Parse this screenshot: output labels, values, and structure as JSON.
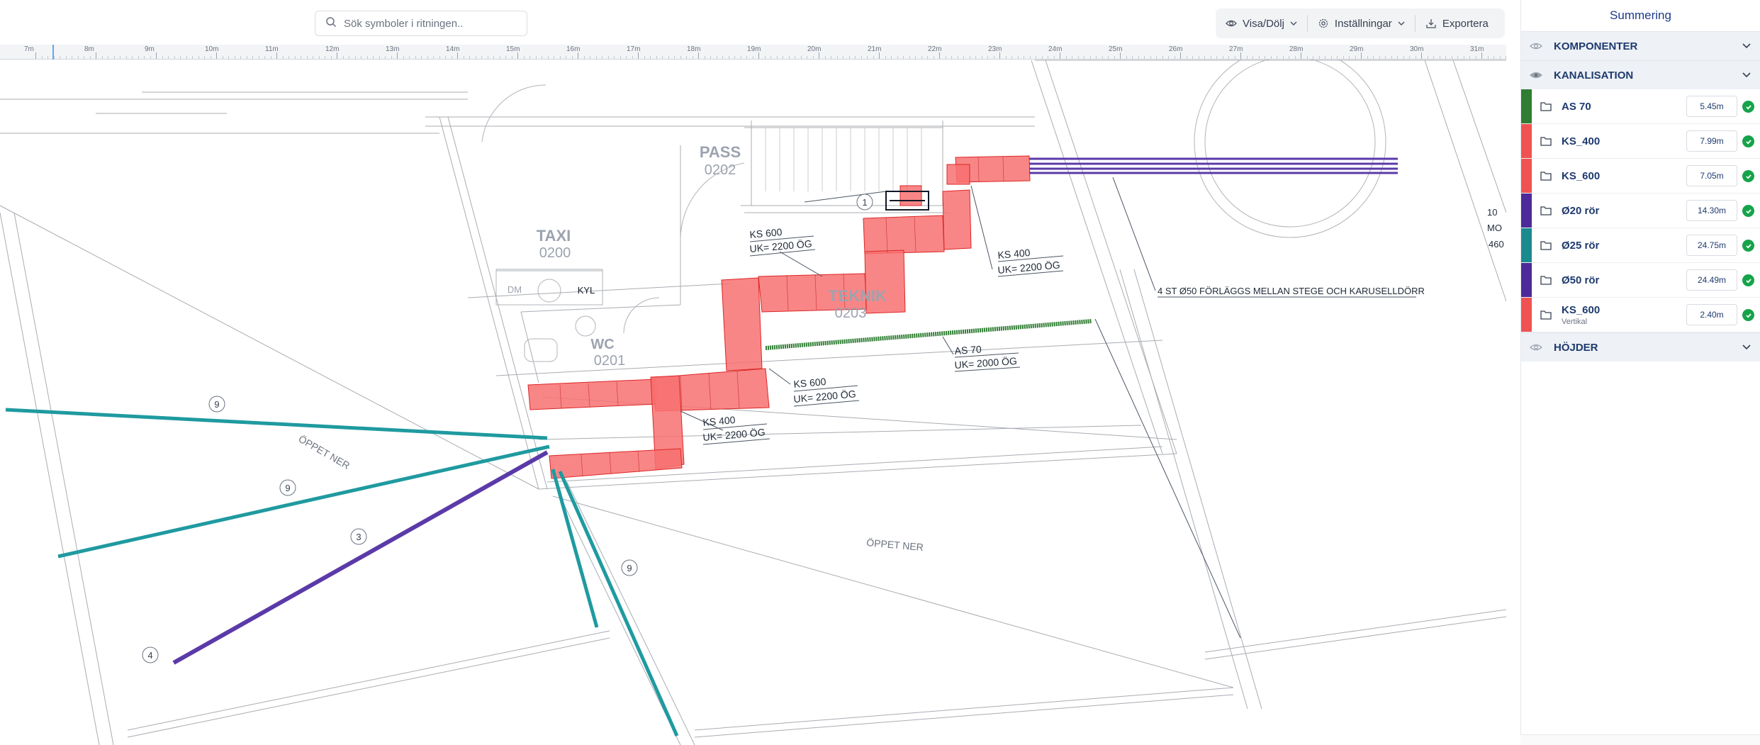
{
  "search": {
    "placeholder": "Sök symboler i ritningen.."
  },
  "toolbar": {
    "show_hide_label": "Visa/Dölj",
    "settings_label": "Inställningar",
    "export_label": "Exportera"
  },
  "ruler": {
    "labels": [
      "7m",
      "8m",
      "9m",
      "10m",
      "11m",
      "12m",
      "13m",
      "14m",
      "15m",
      "16m",
      "17m",
      "18m",
      "19m",
      "20m",
      "21m",
      "22m",
      "23m",
      "24m",
      "25m",
      "26m",
      "27m",
      "28m",
      "29m",
      "30m",
      "31m"
    ]
  },
  "drawing": {
    "rooms": [
      {
        "name": "PASS",
        "number": "0202"
      },
      {
        "name": "TAXI",
        "number": "0200"
      },
      {
        "name": "WC",
        "number": "0201"
      },
      {
        "name": "TEKNIK",
        "number": "0203"
      }
    ],
    "fixtures": {
      "dm": "DM",
      "kyl": "KYL"
    },
    "annotations": {
      "ks600_a": "KS 600",
      "ks600_a_uk": "UK= 2200 ÖG",
      "ks400_a": "KS 400",
      "ks400_a_uk": "UK= 2200 ÖG",
      "ks600_b": "KS 600",
      "ks600_b_uk": "UK= 2200 ÖG",
      "ks400_b": "KS 400",
      "ks400_b_uk": "UK= 2200 ÖG",
      "as70": "AS 70",
      "as70_uk": "UK= 2000 ÖG",
      "note": "4 ST Ø50 FÖRLÄGGS MELLAN STEGE OCH KARUSELLDÖRR",
      "oppet_ner_1": "ÖPPET NER",
      "oppet_ner_2": "ÖPPET NER",
      "edge_a": "10",
      "edge_b": "MO",
      "edge_c": "460"
    },
    "markers": {
      "m1": "1",
      "m3": "3",
      "m4": "4",
      "m9a": "9",
      "m9b": "9",
      "m9c": "9"
    }
  },
  "panel": {
    "title": "Summering",
    "sections": {
      "komponenter": "KOMPONENTER",
      "kanalisation": "KANALISATION",
      "hojder": "HÖJDER"
    },
    "items": [
      {
        "label": "AS 70",
        "value": "5.45m",
        "color": "#2e7d32"
      },
      {
        "label": "KS_400",
        "value": "7.99m",
        "color": "#f05252"
      },
      {
        "label": "KS_600",
        "value": "7.05m",
        "color": "#f05252"
      },
      {
        "label": "Ø20 rör",
        "value": "14.30m",
        "color": "#4c2a99"
      },
      {
        "label": "Ø25 rör",
        "value": "24.75m",
        "color": "#1b8a8f"
      },
      {
        "label": "Ø50 rör",
        "value": "24.49m",
        "color": "#4c2a99"
      },
      {
        "label": "KS_600",
        "sublabel": "Vertikal",
        "value": "2.40m",
        "color": "#f05252"
      }
    ]
  }
}
